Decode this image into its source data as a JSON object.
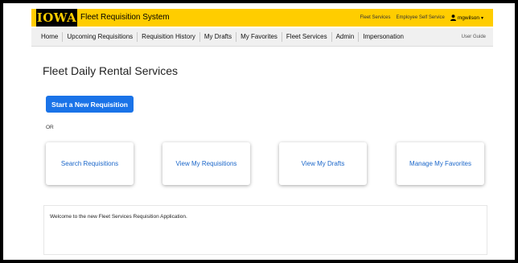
{
  "header": {
    "logo_text": "IOWA",
    "app_title": "Fleet Requisition System",
    "links": [
      "Fleet Services",
      "Employee Self Service"
    ],
    "username": "mgwilson",
    "brand_color": "#FFCD00"
  },
  "nav": {
    "items": [
      "Home",
      "Upcoming Requisitions",
      "Requisition History",
      "My Drafts",
      "My Favorites",
      "Fleet Services",
      "Admin",
      "Impersonation"
    ],
    "user_guide": "User Guide"
  },
  "main": {
    "title": "Fleet Daily Rental Services",
    "start_button": "Start a New Requisition",
    "or_text": "OR",
    "cards": [
      "Search Requisitions",
      "View My Requisitions",
      "View My Drafts",
      "Manage My Favorites"
    ],
    "welcome_text": "Welcome to the new Fleet Services Requisition Application.",
    "accent_color": "#1a73e8"
  }
}
